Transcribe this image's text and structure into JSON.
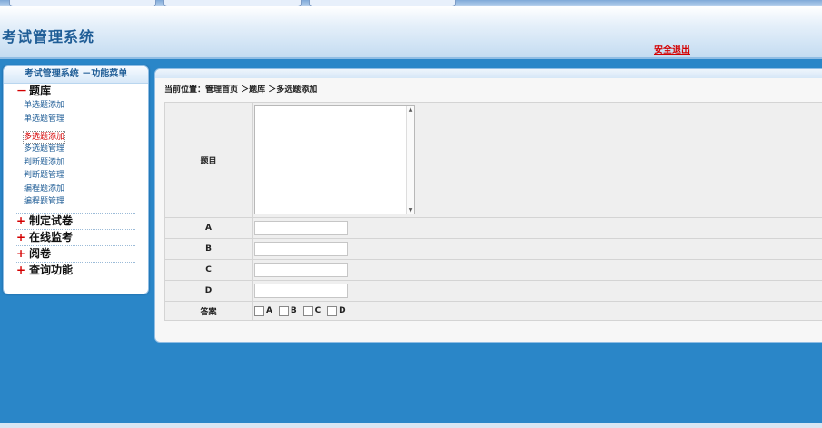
{
  "header": {
    "title": "考试管理系统",
    "logout": "安全退出"
  },
  "sidebar": {
    "title": "考试管理系统 －功能菜单",
    "groups": [
      {
        "sign": "－",
        "label": "题库",
        "items": [
          "单选题添加",
          "单选题管理",
          "多选题添加",
          "多选题管理",
          "判断题添加",
          "判断题管理",
          "编程题添加",
          "编程题管理"
        ]
      },
      {
        "sign": "+",
        "label": "制定试卷"
      },
      {
        "sign": "+",
        "label": "在线监考"
      },
      {
        "sign": "+",
        "label": "阅卷"
      },
      {
        "sign": "+",
        "label": "查询功能"
      }
    ],
    "active_item": "多选题添加"
  },
  "main": {
    "breadcrumb": "当前位置：管理首页 ＞题库 ＞多选题添加",
    "form": {
      "question_label": "题目",
      "question_value": "",
      "options": [
        {
          "label": "A",
          "value": ""
        },
        {
          "label": "B",
          "value": ""
        },
        {
          "label": "C",
          "value": ""
        },
        {
          "label": "D",
          "value": ""
        }
      ],
      "answer_label": "答案",
      "answer_choices": [
        "A",
        "B",
        "C",
        "D"
      ]
    }
  }
}
